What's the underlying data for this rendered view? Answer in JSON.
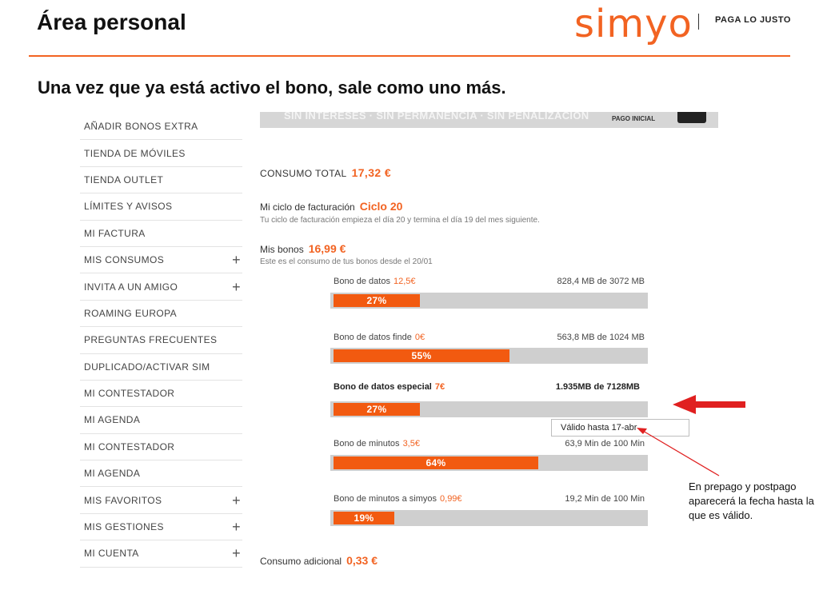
{
  "header": {
    "title": "Área personal",
    "logo": "simyo",
    "tagline": "PAGA LO JUSTO",
    "subtitle": "Una vez que ya está activo el bono, sale como uno más.",
    "accent_color": "#f26322"
  },
  "sidebar": {
    "items": [
      {
        "label": "AÑADIR BONOS EXTRA",
        "expandable": false
      },
      {
        "label": "TIENDA DE MÓVILES",
        "expandable": false
      },
      {
        "label": "TIENDA OUTLET",
        "expandable": false
      },
      {
        "label": "LÍMITES Y AVISOS",
        "expandable": false
      },
      {
        "label": "MI FACTURA",
        "expandable": false
      },
      {
        "label": "MIS CONSUMOS",
        "expandable": true
      },
      {
        "label": "INVITA A UN AMIGO",
        "expandable": true
      },
      {
        "label": "ROAMING EUROPA",
        "expandable": false
      },
      {
        "label": "PREGUNTAS FRECUENTES",
        "expandable": false
      },
      {
        "label": "DUPLICADO/ACTIVAR SIM",
        "expandable": false
      },
      {
        "label": "MI CONTESTADOR",
        "expandable": false
      },
      {
        "label": "MI AGENDA",
        "expandable": false
      },
      {
        "label": "MI CONTESTADOR",
        "expandable": false
      },
      {
        "label": "MI AGENDA",
        "expandable": false
      },
      {
        "label": "MIS FAVORITOS",
        "expandable": true
      },
      {
        "label": "MIS GESTIONES",
        "expandable": true
      },
      {
        "label": "MI CUENTA",
        "expandable": true
      }
    ],
    "expand_symbol": "+"
  },
  "banner": {
    "text": "SIN INTERESES · SIN PERMANENCIA · SIN PENALIZACIÓN",
    "pago_label": "PAGO INICIAL"
  },
  "summary": {
    "consumo_total_label": "CONSUMO TOTAL",
    "consumo_total_value": "17,32 €",
    "ciclo_label": "Mi ciclo de facturación",
    "ciclo_value": "Ciclo 20",
    "ciclo_note": "Tu ciclo de facturación empieza el día 20 y termina el día 19 del mes siguiente.",
    "bonos_label": "Mis bonos",
    "bonos_value": "16,99 €",
    "bonos_note": "Este es el consumo de tus bonos desde el 20/01",
    "adicional_label": "Consumo adicional",
    "adicional_value": "0,33 €"
  },
  "bonos": [
    {
      "name": "Bono de datos",
      "price": "12,5€",
      "usage": "828,4 MB de 3072 MB",
      "percent_label": "27%",
      "fraction": 0.27,
      "highlighted": false
    },
    {
      "name": "Bono de datos finde",
      "price": "0€",
      "usage": "563,8 MB de 1024 MB",
      "percent_label": "55%",
      "fraction": 0.55,
      "highlighted": false
    },
    {
      "name": "Bono de datos especial",
      "price": "7€",
      "usage": "1.935MB de 7128MB",
      "percent_label": "27%",
      "fraction": 0.27,
      "highlighted": true
    },
    {
      "name": "Bono de minutos",
      "price": "3,5€",
      "usage": "63,9 Min de 100 Min",
      "percent_label": "64%",
      "fraction": 0.64,
      "highlighted": false
    },
    {
      "name": "Bono de minutos a simyos",
      "price": "0,99€",
      "usage": "19,2 Min de 100 Min",
      "percent_label": "19%",
      "fraction": 0.19,
      "highlighted": false
    }
  ],
  "validity": {
    "text": "Válido hasta 17-abr"
  },
  "annotation": {
    "text": "En prepago y postpago aparecerá la fecha hasta la que es válido.",
    "arrow_color": "#e02020"
  }
}
